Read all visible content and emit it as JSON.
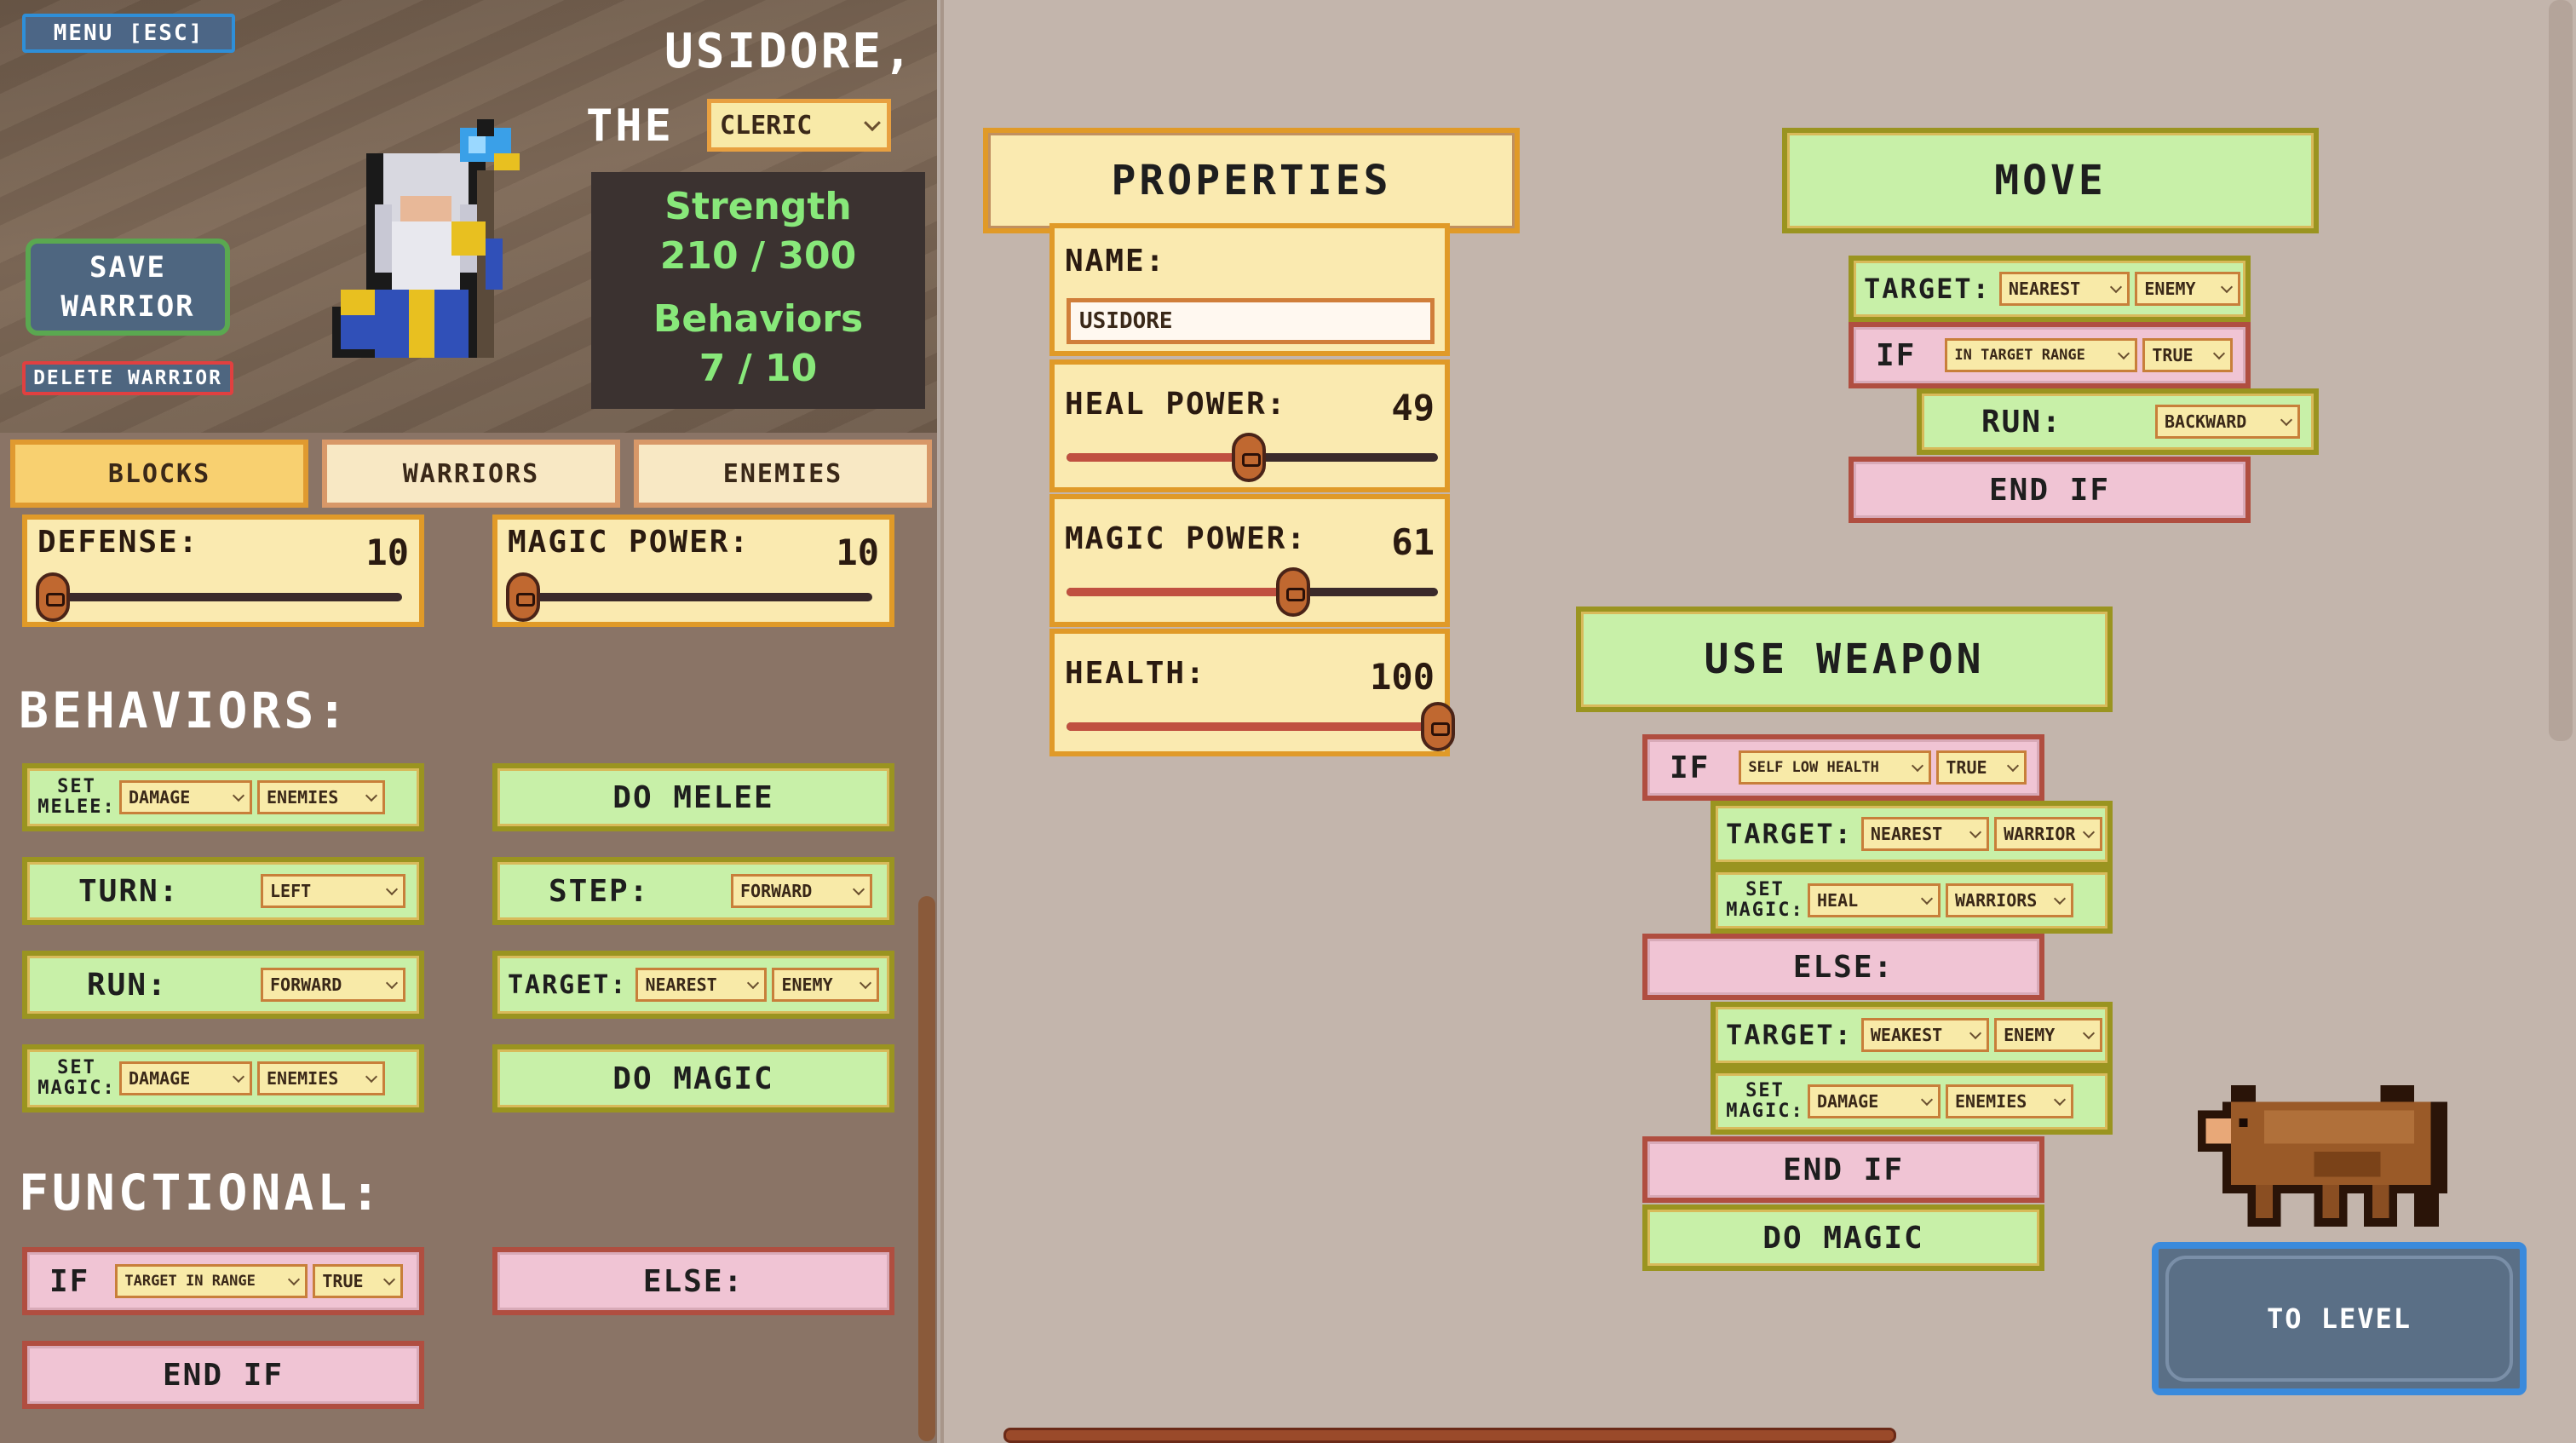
{
  "header": {
    "menu_label": "MENU [ESC]",
    "save_label_1": "SAVE",
    "save_label_2": "WARRIOR",
    "delete_label": "DELETE WARRIOR",
    "warrior_name": "USIDORE,",
    "the_label": "THE",
    "class_value": "CLERIC"
  },
  "stats": {
    "strength_label": "Strength",
    "strength_value": "210 / 300",
    "behaviors_label": "Behaviors",
    "behaviors_value": "7 / 10"
  },
  "tabs": [
    {
      "label": "BLOCKS",
      "active": true
    },
    {
      "label": "WARRIORS",
      "active": false
    },
    {
      "label": "ENEMIES",
      "active": false
    }
  ],
  "palette": {
    "left_sliders": [
      {
        "label": "DEFENSE:",
        "value": "10",
        "level": 0.0
      },
      {
        "label": "MAGIC POWER:",
        "value": "10",
        "level": 0.0
      }
    ],
    "behaviors_title": "BEHAVIORS:",
    "functional_title": "FUNCTIONAL:",
    "set_melee": {
      "label_1": "SET",
      "label_2": "MELEE:",
      "opt1": "DAMAGE",
      "opt2": "ENEMIES"
    },
    "do_melee": "DO MELEE",
    "turn": {
      "label": "TURN:",
      "opt": "LEFT"
    },
    "step": {
      "label": "STEP:",
      "opt": "FORWARD"
    },
    "run": {
      "label": "RUN:",
      "opt": "FORWARD"
    },
    "target": {
      "label": "TARGET:",
      "opt1": "NEAREST",
      "opt2": "ENEMY"
    },
    "set_magic": {
      "label_1": "SET",
      "label_2": "MAGIC:",
      "opt1": "DAMAGE",
      "opt2": "ENEMIES"
    },
    "do_magic": "DO MAGIC",
    "if": {
      "label": "IF",
      "opt1": "TARGET IN RANGE",
      "opt2": "TRUE"
    },
    "else": "ELSE:",
    "end_if": "END IF"
  },
  "properties": {
    "title": "PROPERTIES",
    "name_label": "NAME:",
    "name_value": "USIDORE",
    "heal_power": {
      "label": "HEAL POWER:",
      "value": "49",
      "level": 0.49
    },
    "magic_power": {
      "label": "MAGIC POWER:",
      "value": "61",
      "level": 0.61
    },
    "health": {
      "label": "HEALTH:",
      "value": "100",
      "level": 1.0
    }
  },
  "move": {
    "title": "MOVE",
    "target": {
      "label": "TARGET:",
      "opt1": "NEAREST",
      "opt2": "ENEMY"
    },
    "if": {
      "label": "IF",
      "opt1": "IN TARGET RANGE",
      "opt2": "TRUE"
    },
    "run": {
      "label": "RUN:",
      "opt": "BACKWARD"
    },
    "end_if": "END IF"
  },
  "use_weapon": {
    "title": "USE WEAPON",
    "if": {
      "label": "IF",
      "opt1": "SELF LOW HEALTH",
      "opt2": "TRUE"
    },
    "target1": {
      "label": "TARGET:",
      "opt1": "NEAREST",
      "opt2": "WARRIOR"
    },
    "set_magic1": {
      "label_1": "SET",
      "label_2": "MAGIC:",
      "opt1": "HEAL",
      "opt2": "WARRIORS"
    },
    "else": "ELSE:",
    "target2": {
      "label": "TARGET:",
      "opt1": "WEAKEST",
      "opt2": "ENEMY"
    },
    "set_magic2": {
      "label_1": "SET",
      "label_2": "MAGIC:",
      "opt1": "DAMAGE",
      "opt2": "ENEMIES"
    },
    "end_if": "END IF",
    "do_magic": "DO MAGIC"
  },
  "to_level": "TO LEVEL",
  "colors": {
    "block_green": "#c8f0a8",
    "block_pink": "#f0c4d4",
    "block_yellow": "#faeab0",
    "accent_blue": "#3a8adc",
    "stat_green": "#88e87a"
  }
}
